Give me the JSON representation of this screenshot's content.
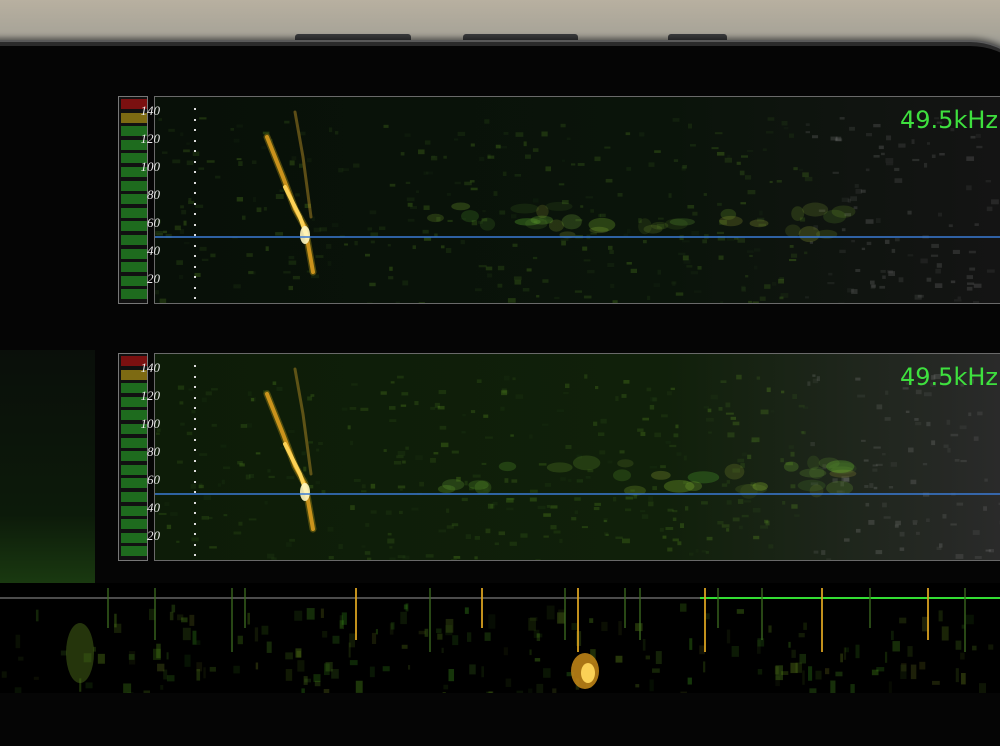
{
  "panels": [
    {
      "ticks": [
        "140",
        "120",
        "100",
        "80",
        "60",
        "40",
        "20"
      ],
      "frequency": "49.5kHz"
    },
    {
      "ticks": [
        "140",
        "120",
        "100",
        "80",
        "60",
        "40",
        "20"
      ],
      "frequency": "49.5kHz"
    }
  ],
  "colors": {
    "readout": "#3ee03e",
    "marker_line": "#3a7bd5",
    "meter_green": "#1e6b1e",
    "meter_yellow": "#7d6a12",
    "meter_red": "#7a1010",
    "call_hot": "#ffd65a",
    "timeline_line": "#33dd33"
  }
}
